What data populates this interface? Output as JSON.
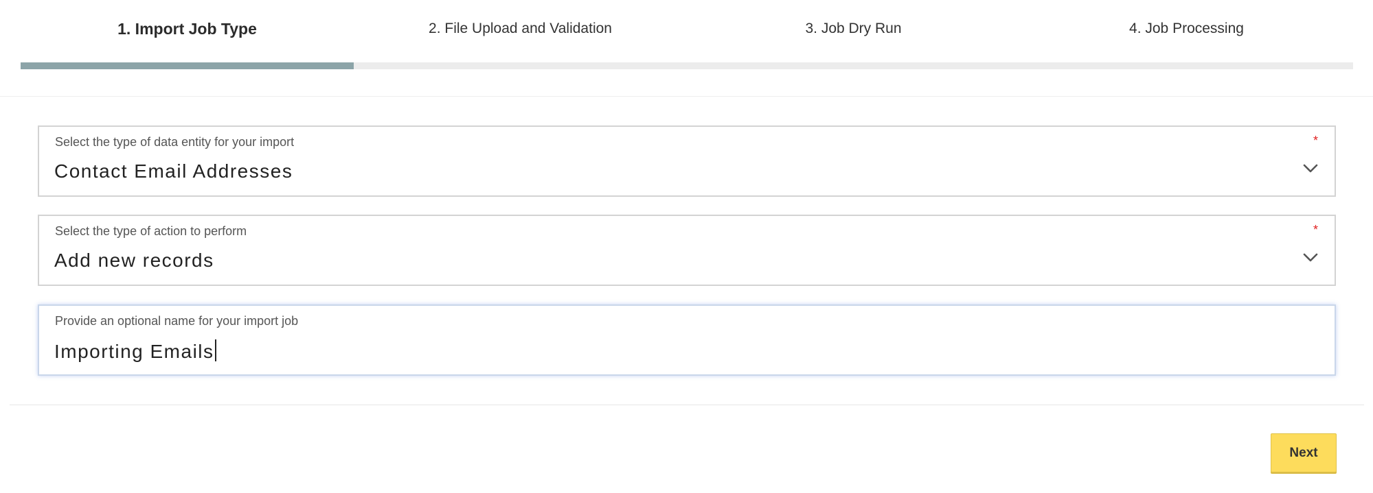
{
  "stepper": {
    "steps": [
      {
        "label": "1. Import Job Type",
        "active": true
      },
      {
        "label": "2. File Upload and Validation",
        "active": false
      },
      {
        "label": "3. Job Dry Run",
        "active": false
      },
      {
        "label": "4. Job Processing",
        "active": false
      }
    ],
    "progress_fraction": 0.25,
    "progress_color": "#8ca4a8"
  },
  "form": {
    "entity": {
      "label": "Select the type of data entity for your import",
      "required_mark": "*",
      "value": "Contact Email Addresses",
      "icon": "chevron-down-icon"
    },
    "action": {
      "label": "Select the type of action to perform",
      "required_mark": "*",
      "value": "Add new records",
      "icon": "chevron-down-icon"
    },
    "job_name": {
      "label": "Provide an optional name for your import job",
      "value": "Importing Emails"
    }
  },
  "footer": {
    "next_label": "Next",
    "next_color": "#fddc5c"
  }
}
